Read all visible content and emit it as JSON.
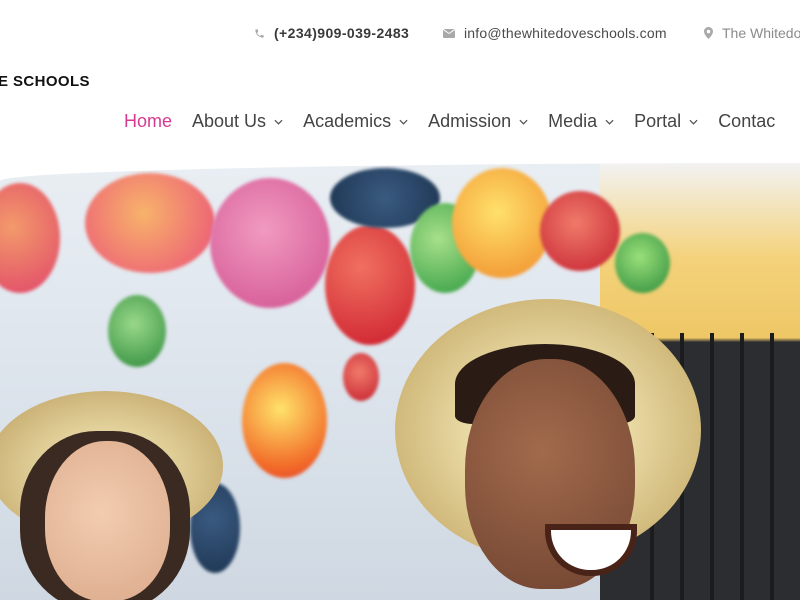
{
  "topbar": {
    "phone": "(+234)909-039-2483",
    "email": "info@thewhitedoveschools.com",
    "address": "The Whitedov"
  },
  "logo": {
    "text": "E SCHOOLS"
  },
  "nav": {
    "items": [
      {
        "label": "Home",
        "active": true,
        "has_dropdown": false
      },
      {
        "label": "About Us",
        "active": false,
        "has_dropdown": true
      },
      {
        "label": "Academics",
        "active": false,
        "has_dropdown": true
      },
      {
        "label": "Admission",
        "active": false,
        "has_dropdown": true
      },
      {
        "label": "Media",
        "active": false,
        "has_dropdown": true
      },
      {
        "label": "Portal",
        "active": false,
        "has_dropdown": true
      },
      {
        "label": "Contac",
        "active": false,
        "has_dropdown": false
      }
    ]
  },
  "colors": {
    "accent": "#d63a8f",
    "nav_text": "#444444",
    "icon": "#a9a9a9"
  },
  "icons": {
    "phone": "phone-icon",
    "email": "envelope-icon",
    "address": "map-pin-icon",
    "dropdown": "chevron-down-icon"
  },
  "hero": {
    "image": "students-in-straw-hats-photo"
  }
}
